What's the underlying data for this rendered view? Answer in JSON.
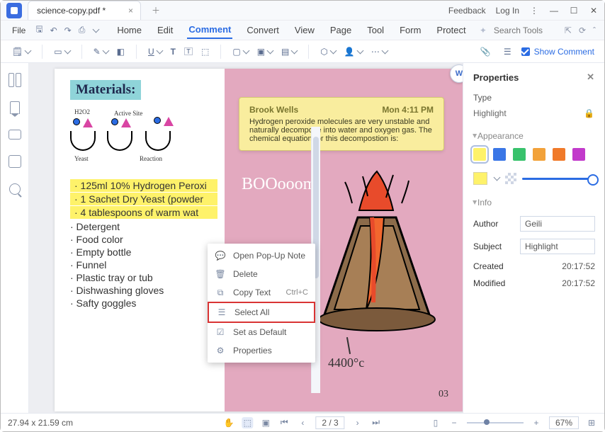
{
  "titlebar": {
    "tab_title": "science-copy.pdf *",
    "feedback": "Feedback",
    "login": "Log In"
  },
  "menubar": {
    "file": "File",
    "items": [
      "Home",
      "Edit",
      "Comment",
      "Convert",
      "View",
      "Page",
      "Tool",
      "Form",
      "Protect"
    ],
    "active_index": 2,
    "search_placeholder": "Search Tools"
  },
  "toolbar": {
    "show_comment": "Show Comment"
  },
  "document": {
    "materials_title": "Materials:",
    "diagram_labels": {
      "h2o2": "H2O2",
      "activesite": "Active Site",
      "yeast": "Yeast",
      "reaction": "Reaction"
    },
    "hl_items": [
      "125ml 10% Hydrogen Peroxi",
      "1 Sachet Dry Yeast (powder",
      "4 tablespoons of warm wat"
    ],
    "plain_items": [
      "Detergent",
      "Food color",
      "Empty bottle",
      "Funnel",
      "Plastic tray or tub",
      "Dishwashing gloves",
      "Safty goggles"
    ],
    "boom_text": "BOOooom!",
    "temp_text": "4400°c",
    "page_number": "03",
    "note": {
      "author": "Brook Wells",
      "time": "Mon 4:11 PM",
      "text": "Hydrogen peroxide molecules are very unstable and naturally decompose into water and oxygen gas. The chemical equation for this decompostion is:"
    }
  },
  "context_menu": {
    "items": [
      {
        "label": "Open Pop-Up Note",
        "icon": "💬"
      },
      {
        "label": "Delete",
        "icon": "🗑"
      },
      {
        "label": "Copy Text",
        "icon": "⧉",
        "shortcut": "Ctrl+C"
      },
      {
        "label": "Select All",
        "icon": "☰",
        "marked": true
      },
      {
        "label": "Set as Default",
        "icon": "☑"
      },
      {
        "label": "Properties",
        "icon": "⚙"
      }
    ]
  },
  "properties": {
    "title": "Properties",
    "type_label": "Type",
    "type_value": "Highlight",
    "appearance_label": "Appearance",
    "swatches": [
      "#fef26a",
      "#3a76e6",
      "#38c26c",
      "#f2a23a",
      "#f07a2a",
      "#c23acb"
    ],
    "info_label": "Info",
    "author_label": "Author",
    "author_value": "Geili",
    "subject_label": "Subject",
    "subject_value": "Highlight",
    "created_label": "Created",
    "created_value": "20:17:52",
    "modified_label": "Modified",
    "modified_value": "20:17:52"
  },
  "statusbar": {
    "coords": "27.94 x 21.59 cm",
    "page": "2 / 3",
    "zoom": "67%"
  }
}
